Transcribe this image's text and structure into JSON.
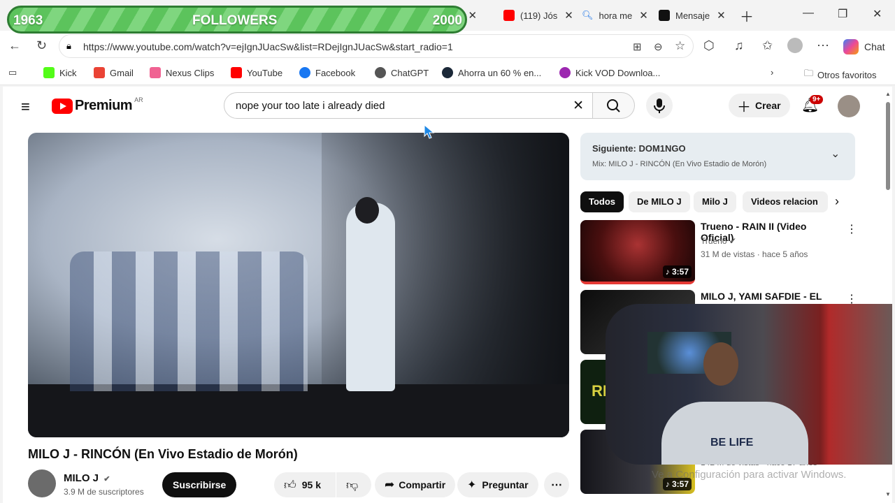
{
  "followers": {
    "current": "1963",
    "label": "FOLLOWERS",
    "goal": "2000"
  },
  "tabs": [
    {
      "label": "(119) Jós",
      "icon": "youtube-icon"
    },
    {
      "label": "hora me",
      "icon": "search-icon"
    },
    {
      "label": "Mensaje",
      "icon": "tiktok-icon"
    }
  ],
  "browser": {
    "url": "https://www.youtube.com/watch?v=ejIgnJUacSw&list=RDejIgnJUacSw&start_radio=1",
    "chat_label": "Chat",
    "other_favorites": "Otros favoritos"
  },
  "bookmarks": [
    {
      "label": "Kick",
      "color": "#53fc18"
    },
    {
      "label": "Gmail",
      "color": "#ea4335"
    },
    {
      "label": "Nexus Clips",
      "color": "#f06292"
    },
    {
      "label": "YouTube",
      "color": "#ff0000"
    },
    {
      "label": "Facebook",
      "color": "#1877f2"
    },
    {
      "label": "ChatGPT",
      "color": "#555555"
    },
    {
      "label": "Ahorra un 60 % en...",
      "color": "#1b2838"
    },
    {
      "label": "Kick VOD Downloa...",
      "color": "#9c27b0"
    }
  ],
  "youtube": {
    "logo_text": "Premium",
    "region": "AR",
    "search_query": "nope your too late i already died",
    "create_label": "Crear",
    "notif_count": "9+"
  },
  "video": {
    "title": "MILO J - RINCÓN (En Vivo Estadio de Morón)",
    "channel": "MILO J",
    "subscribers": "3.9 M de suscriptores",
    "subscribe_label": "Suscribirse",
    "likes": "95 k",
    "share_label": "Compartir",
    "ask_label": "Preguntar"
  },
  "next": {
    "heading": "Siguiente: DOM1NGO",
    "mix": "Mix: MILO J - RINCÓN (En Vivo Estadio de Morón)"
  },
  "chips": [
    "Todos",
    "De MILO J",
    "Milo J",
    "Videos relacion"
  ],
  "related": [
    {
      "title": "Trueno - RAIN II (Video Oficial)",
      "channel": "Trueno",
      "meta": "31 M de vistas · hace 5 años",
      "duration": "3:57"
    },
    {
      "title": "MILO J, YAMI SAFDIE - EL",
      "channel": "",
      "meta": "",
      "duration": ""
    },
    {
      "title": "",
      "channel": "",
      "meta": "142 M de vistas · hace 17 años",
      "duration": "3:57"
    }
  ],
  "watermark": "Ve a Configuración para activar Windows."
}
